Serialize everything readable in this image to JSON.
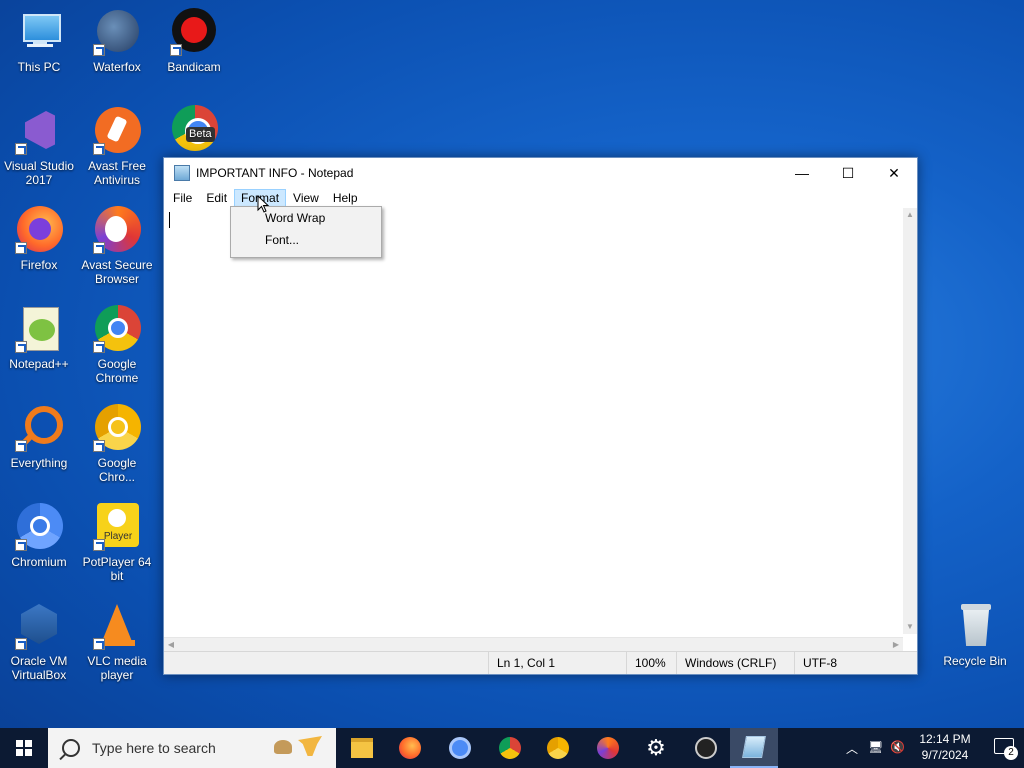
{
  "desktop": {
    "icons": [
      {
        "label": "This PC"
      },
      {
        "label": "Waterfox"
      },
      {
        "label": "Bandicam"
      },
      {
        "label": "Visual Studio 2017"
      },
      {
        "label": "Avast Free Antivirus"
      },
      {
        "label": "Google Chrome Beta",
        "badge": "Beta"
      },
      {
        "label": "Firefox"
      },
      {
        "label": "Avast Secure Browser"
      },
      {
        "label": "Notepad++"
      },
      {
        "label": "Google Chrome"
      },
      {
        "label": "Everything"
      },
      {
        "label": "Google Chro..."
      },
      {
        "label": "Chromium"
      },
      {
        "label": "PotPlayer 64 bit",
        "badge": "Player"
      },
      {
        "label": "Oracle VM VirtualBox"
      },
      {
        "label": "VLC media player"
      },
      {
        "label": "Recycle Bin"
      }
    ]
  },
  "notepad": {
    "title": "IMPORTANT INFO - Notepad",
    "controls": {
      "minimize": "—",
      "maximize": "☐",
      "close": "✕"
    },
    "menu": [
      "File",
      "Edit",
      "Format",
      "View",
      "Help"
    ],
    "active_menu": "Format",
    "format_menu": [
      "Word Wrap",
      "Font..."
    ],
    "content": "",
    "status": {
      "position": "Ln 1, Col 1",
      "zoom": "100%",
      "line_ending": "Windows (CRLF)",
      "encoding": "UTF-8"
    }
  },
  "taskbar": {
    "search_placeholder": "Type here to search",
    "clock_time": "12:14 PM",
    "clock_date": "9/7/2024",
    "notification_count": "2"
  }
}
